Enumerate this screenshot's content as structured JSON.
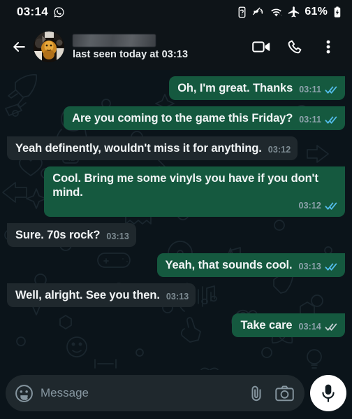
{
  "statusbar": {
    "clock": "03:14",
    "app_icon": "whatsapp-icon",
    "battery_saver_icon": "battery-saver-icon",
    "mute_icon": "ringer-muted-icon",
    "wifi_icon": "wifi-icon",
    "airplane_icon": "airplane-mode-icon",
    "battery_percent": "61%",
    "battery_icon": "battery-charging-icon"
  },
  "header": {
    "back_icon": "back-arrow-icon",
    "avatar": "contact-avatar",
    "contact_name": "",
    "contact_name_redacted": true,
    "status": "last seen today at 03:13",
    "video_call_icon": "video-call-icon",
    "voice_call_icon": "phone-call-icon",
    "overflow_icon": "more-options-icon"
  },
  "colors": {
    "outgoing_bubble": "#15593F",
    "incoming_bubble": "#1F282D",
    "chat_background": "#0B141A",
    "header_background": "#0E1418",
    "read_tick": "#53BDEB",
    "delivered_tick": "#C5CFD3",
    "mic_button": "#FFFFFF"
  },
  "messages": [
    {
      "id": 1,
      "direction": "out",
      "text": "Oh, I'm great. Thanks",
      "time": "03:11",
      "status": "read",
      "wrap": false
    },
    {
      "id": 2,
      "direction": "out",
      "text": "Are you coming to the game this Friday?",
      "time": "03:11",
      "status": "read",
      "wrap": false
    },
    {
      "id": 3,
      "direction": "in",
      "text": "Yeah definently, wouldn't miss it for anything.",
      "time": "03:12",
      "status": "none",
      "wrap": false
    },
    {
      "id": 4,
      "direction": "out",
      "text": "Cool. Bring me some vinyls you have if you don't mind.",
      "time": "03:12",
      "status": "read",
      "wrap": true
    },
    {
      "id": 5,
      "direction": "in",
      "text": "Sure. 70s rock?",
      "time": "03:13",
      "status": "none",
      "wrap": false
    },
    {
      "id": 6,
      "direction": "out",
      "text": "Yeah, that sounds cool.",
      "time": "03:13",
      "status": "read",
      "wrap": false
    },
    {
      "id": 7,
      "direction": "in",
      "text": "Well, alright. See you then.",
      "time": "03:13",
      "status": "none",
      "wrap": false
    },
    {
      "id": 8,
      "direction": "out",
      "text": "Take care",
      "time": "03:14",
      "status": "delivered",
      "wrap": false
    }
  ],
  "composer": {
    "emoji_icon": "emoji-sticker-icon",
    "placeholder": "Message",
    "value": "",
    "attach_icon": "paperclip-icon",
    "camera_icon": "camera-icon",
    "mic_icon": "microphone-icon"
  }
}
